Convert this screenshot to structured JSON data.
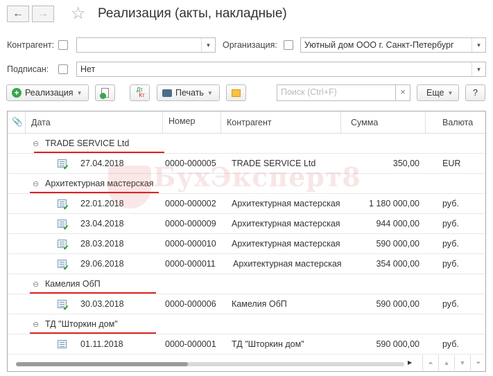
{
  "header": {
    "title": "Реализация (акты, накладные)",
    "back": "←",
    "forward": "→",
    "favorite": "☆"
  },
  "filters": {
    "counterparty_label": "Контрагент:",
    "counterparty_value": "",
    "organization_label": "Организация:",
    "organization_value": "Уютный дом ООО г. Санкт-Петербург",
    "signed_label": "Подписан:",
    "signed_value": "Нет"
  },
  "toolbar": {
    "create": "Реализация",
    "dtkt_top": "Дт",
    "dtkt_bottom": "Кт",
    "print": "Печать",
    "search_placeholder": "Поиск (Ctrl+F)",
    "clear": "×",
    "more": "Еще",
    "help": "?"
  },
  "table": {
    "columns": [
      "Дата",
      "Номер",
      "Контрагент",
      "Сумма",
      "Валюта"
    ],
    "groups": [
      {
        "name": "TRADE SERVICE Ltd",
        "rows": [
          {
            "date": "27.04.2018",
            "number": "0000-000005",
            "counterparty": "TRADE SERVICE Ltd",
            "sum": "350,00",
            "currency": "EUR",
            "posted": true
          }
        ]
      },
      {
        "name": "Архитектурная мастерская",
        "rows": [
          {
            "date": "22.01.2018",
            "number": "0000-000002",
            "counterparty": "Архитектурная мастерская",
            "sum": "1 180 000,00",
            "currency": "руб.",
            "posted": true
          },
          {
            "date": "23.04.2018",
            "number": "0000-000009",
            "counterparty": "Архитектурная мастерская",
            "sum": "944 000,00",
            "currency": "руб.",
            "posted": true
          },
          {
            "date": "28.03.2018",
            "number": "0000-000010",
            "counterparty": "Архитектурная мастерская",
            "sum": "590 000,00",
            "currency": "руб.",
            "posted": true
          },
          {
            "date": "29.06.2018",
            "number": "0000-000011",
            "counterparty": "Архитектурная мастерская",
            "sum": "354 000,00",
            "currency": "руб.",
            "posted": true
          }
        ]
      },
      {
        "name": "Камелия ОбП",
        "rows": [
          {
            "date": "30.03.2018",
            "number": "0000-000006",
            "counterparty": "Камелия ОбП",
            "sum": "590 000,00",
            "currency": "руб.",
            "posted": true
          }
        ]
      },
      {
        "name": "ТД \"Шторкин дом\"",
        "rows": [
          {
            "date": "01.11.2018",
            "number": "0000-000001",
            "counterparty": "ТД \"Шторкин дом\"",
            "sum": "590 000,00",
            "currency": "руб.",
            "posted": false
          }
        ]
      }
    ]
  },
  "watermark": "БухЭксперт8",
  "colors": {
    "accent_underline": "#e0201d",
    "posted_check": "#2e9e2e"
  }
}
